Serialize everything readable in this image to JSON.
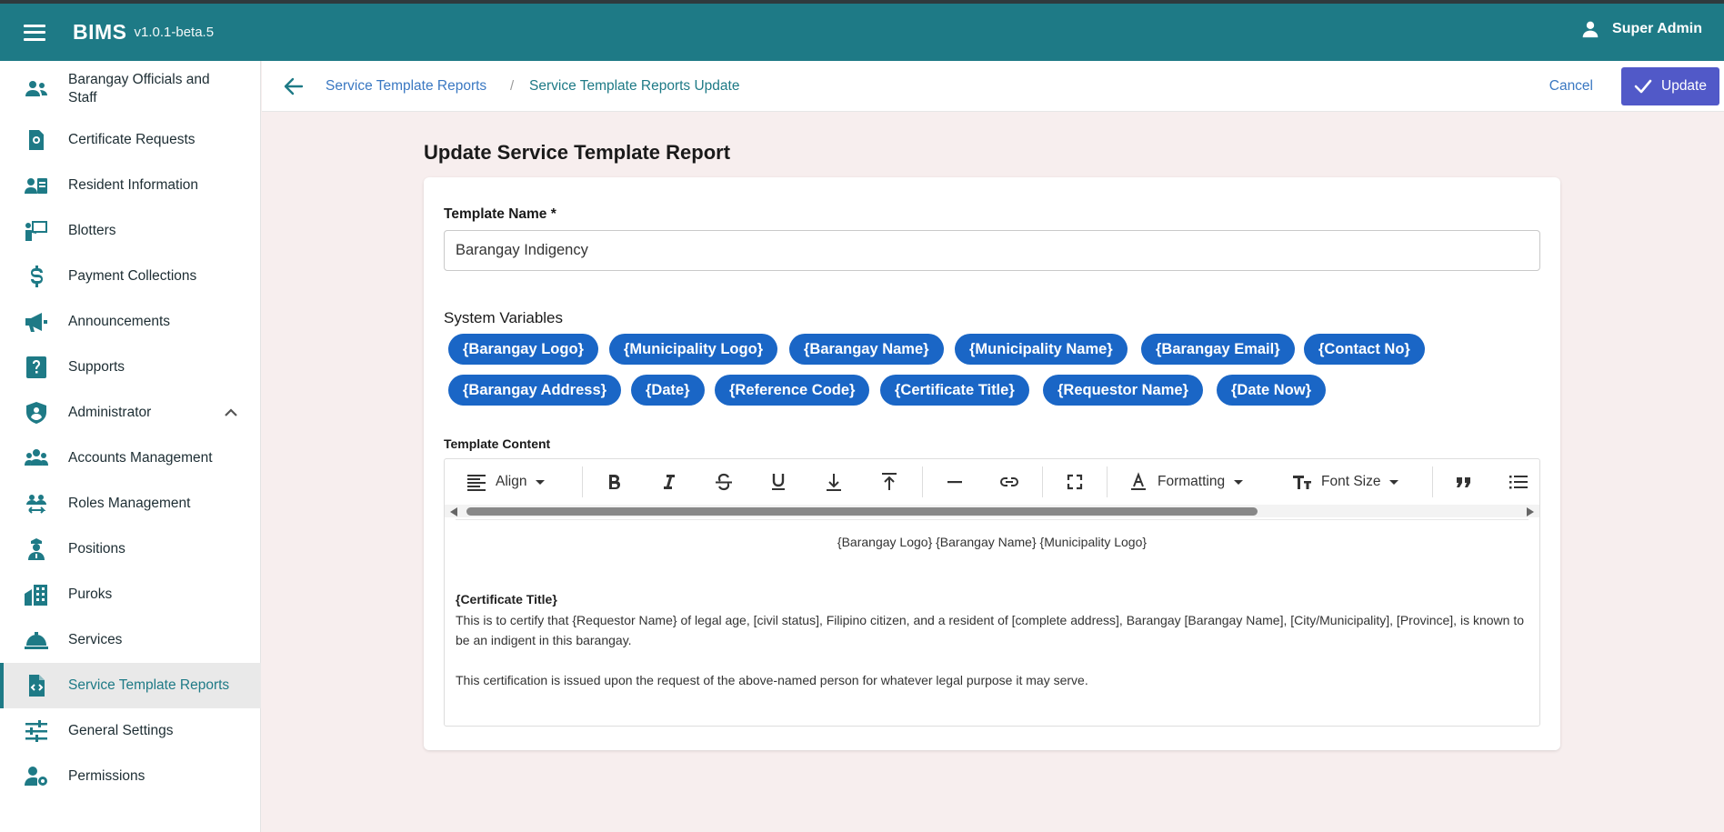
{
  "app": {
    "name": "BIMS",
    "version": "v1.0.1-beta.5",
    "user_name": "Super Admin"
  },
  "sidebar": {
    "items": [
      {
        "label": "Barangay Officials and Staff",
        "icon": "users-icon"
      },
      {
        "label": "Certificate Requests",
        "icon": "certificate-icon"
      },
      {
        "label": "Resident Information",
        "icon": "id-card-icon"
      },
      {
        "label": "Blotters",
        "icon": "presentation-icon"
      },
      {
        "label": "Payment Collections",
        "icon": "dollar-icon"
      },
      {
        "label": "Announcements",
        "icon": "megaphone-icon"
      },
      {
        "label": "Supports",
        "icon": "help-icon"
      },
      {
        "label": "Administrator",
        "icon": "shield-user-icon"
      },
      {
        "label": "Accounts Management",
        "icon": "group-icon"
      },
      {
        "label": "Roles Management",
        "icon": "swap-users-icon"
      },
      {
        "label": "Positions",
        "icon": "officer-icon"
      },
      {
        "label": "Puroks",
        "icon": "buildings-icon"
      },
      {
        "label": "Services",
        "icon": "bell-tray-icon"
      },
      {
        "label": "Service Template Reports",
        "icon": "file-code-icon"
      },
      {
        "label": "General Settings",
        "icon": "sliders-icon"
      },
      {
        "label": "Permissions",
        "icon": "user-gear-icon"
      }
    ],
    "active": "Service Template Reports"
  },
  "breadcrumb": {
    "parent": "Service Template Reports",
    "separator": "/",
    "current": "Service Template Reports Update"
  },
  "actions": {
    "cancel": "Cancel",
    "update": "Update"
  },
  "page": {
    "title": "Update Service Template Report"
  },
  "form": {
    "template_name_label": "Template Name *",
    "template_name_value": "Barangay Indigency",
    "system_variables_label": "System Variables",
    "system_variables": [
      "{Barangay Logo}",
      "{Municipality Logo}",
      "{Barangay Name}",
      "{Municipality Name}",
      "{Barangay Email}",
      "{Contact No}",
      "{Barangay Address}",
      "{Date}",
      "{Reference Code}",
      "{Certificate Title}",
      "{Requestor Name}",
      "{Date Now}"
    ],
    "template_content_label": "Template Content"
  },
  "editor": {
    "toolbar": {
      "align": "Align",
      "formatting": "Formatting",
      "font_size": "Font Size"
    },
    "content": {
      "header_line": "{Barangay Logo} {Barangay Name} {Municipality Logo}",
      "certificate_title": "{Certificate Title}",
      "paragraph1": "This is to certify that {Requestor Name}  of legal age, [civil status], Filipino citizen, and a resident of [complete address], Barangay [Barangay Name], [City/Municipality], [Province], is known to be an indigent in this barangay.",
      "paragraph2": "This certification is issued upon the request of the above-named person for whatever legal purpose it may serve."
    }
  },
  "colors": {
    "primary": "#1e7a86",
    "chip": "#1a66c6",
    "update_button": "#5159c8",
    "link": "#3a78c2",
    "page_bg": "#f7eeee"
  }
}
